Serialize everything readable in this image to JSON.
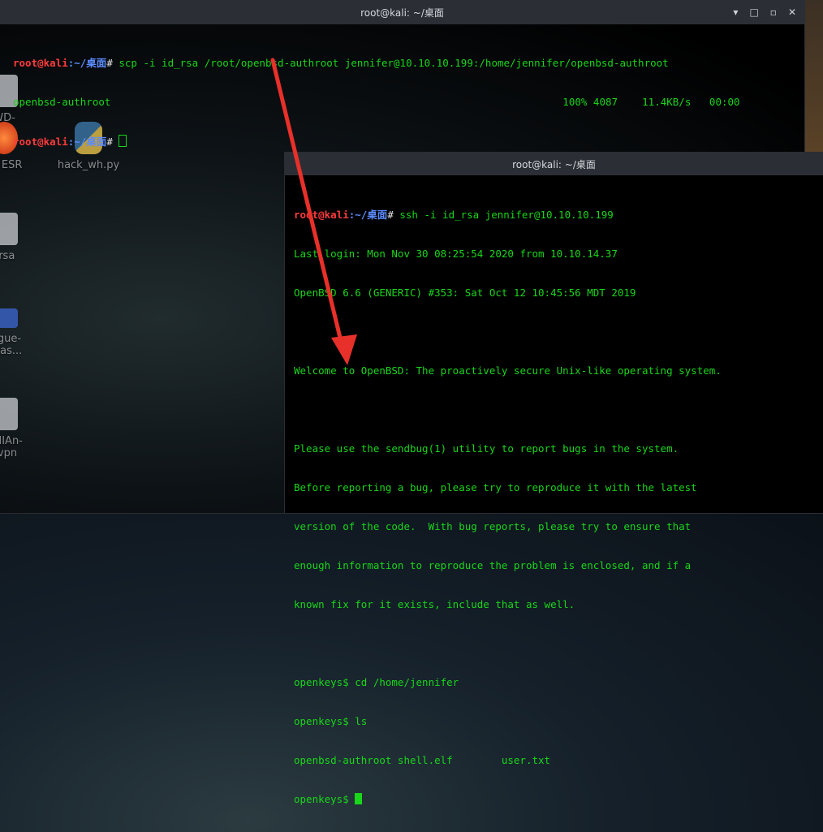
{
  "desktop": {
    "icons": [
      {
        "label": "WD-\nkey",
        "kind": "doc"
      },
      {
        "label": "ox ESR",
        "kind": "fox"
      },
      {
        "label": "hack_wh.py",
        "kind": "py"
      },
      {
        "label": "_rsa",
        "kind": "doc"
      },
      {
        "label": "rogue-\n-mas...",
        "kind": "blue"
      },
      {
        "label": "AMIAn-\novpn",
        "kind": "doc"
      }
    ]
  },
  "window_back": {
    "title": "root@kali: ~/桌面",
    "controls": {
      "minimize": "▾",
      "restore": "□",
      "maximize": "▫",
      "close": "✕"
    },
    "lines": [
      {
        "user": "root@kali",
        "path": ":~/桌面",
        "prompt": "# ",
        "cmd": "scp -i id_rsa /root/openbsd-authroot jennifer@10.10.10.199:/home/jennifer/openbsd-authroot"
      },
      {
        "text": "openbsd-authroot                                                                          100% 4087    11.4KB/s   00:00"
      },
      {
        "user": "root@kali",
        "path": ":~/桌面",
        "prompt": "# ",
        "cmd": ""
      }
    ]
  },
  "window_front": {
    "title": "root@kali: ~/桌面",
    "lines": [
      {
        "user": "root@kali",
        "path": ":~/桌面",
        "prompt": "# ",
        "cmd": "ssh -i id_rsa jennifer@10.10.10.199"
      },
      {
        "text": "Last login: Mon Nov 30 08:25:54 2020 from 10.10.14.37"
      },
      {
        "text": "OpenBSD 6.6 (GENERIC) #353: Sat Oct 12 10:45:56 MDT 2019"
      },
      {
        "text": ""
      },
      {
        "text": "Welcome to OpenBSD: The proactively secure Unix-like operating system."
      },
      {
        "text": ""
      },
      {
        "text": "Please use the sendbug(1) utility to report bugs in the system."
      },
      {
        "text": "Before reporting a bug, please try to reproduce it with the latest"
      },
      {
        "text": "version of the code.  With bug reports, please try to ensure that"
      },
      {
        "text": "enough information to reproduce the problem is enclosed, and if a"
      },
      {
        "text": "known fix for it exists, include that as well."
      },
      {
        "text": ""
      },
      {
        "text": "openkeys$ cd /home/jennifer"
      },
      {
        "text": "openkeys$ ls"
      },
      {
        "text": "openbsd-authroot shell.elf        user.txt"
      },
      {
        "text": "openkeys$ ",
        "cursor": true
      }
    ]
  },
  "colors": {
    "terminal_green": "#19d61a",
    "prompt_user_red": "#ff3b3b",
    "prompt_path_blue": "#5b8cff",
    "annotation_arrow": "#e8302a"
  }
}
